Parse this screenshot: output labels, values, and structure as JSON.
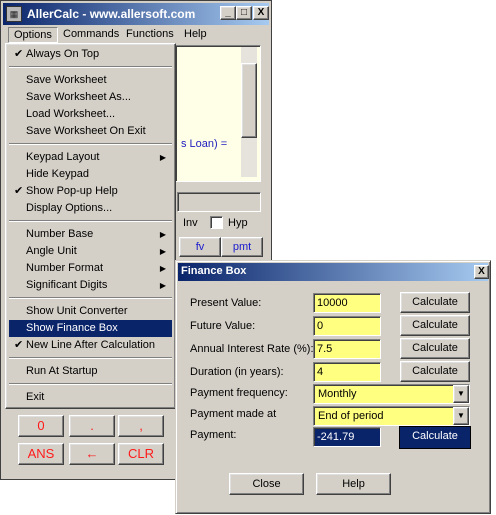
{
  "calc_window": {
    "title": "AllerCalc - www.allersoft.com",
    "app_icon": "calculator-icon",
    "minimize": "_",
    "maximize": "□",
    "close": "X",
    "menubar": [
      "Options",
      "Commands",
      "Functions",
      "Help"
    ],
    "worksheet_text": "s Loan) =",
    "inv_label": "Inv",
    "hyp_label": "Hyp",
    "fn_buttons": [
      "fv",
      "pmt"
    ],
    "keypad_row1": [
      "0",
      ".",
      ","
    ],
    "keypad_row2": [
      "ANS",
      "←",
      "CLR"
    ]
  },
  "options_menu": {
    "items": [
      {
        "label": "Always On Top",
        "checked": true
      },
      {
        "sep": true
      },
      {
        "label": "Save Worksheet"
      },
      {
        "label": "Save Worksheet As..."
      },
      {
        "label": "Load Worksheet..."
      },
      {
        "label": "Save Worksheet On Exit"
      },
      {
        "sep": true
      },
      {
        "label": "Keypad Layout",
        "submenu": true
      },
      {
        "label": "Hide Keypad"
      },
      {
        "label": "Show Pop-up Help",
        "checked": true
      },
      {
        "label": "Display Options..."
      },
      {
        "sep": true
      },
      {
        "label": "Number Base",
        "submenu": true
      },
      {
        "label": "Angle Unit",
        "submenu": true
      },
      {
        "label": "Number Format",
        "submenu": true
      },
      {
        "label": "Significant Digits",
        "submenu": true
      },
      {
        "sep": true
      },
      {
        "label": "Show Unit Converter"
      },
      {
        "label": "Show Finance Box",
        "selected": true
      },
      {
        "label": "New Line After Calculation",
        "checked": true
      },
      {
        "sep": true
      },
      {
        "label": "Run At Startup"
      },
      {
        "sep": true
      },
      {
        "label": "Exit"
      }
    ]
  },
  "finance_box": {
    "title": "Finance Box",
    "close": "X",
    "rows": [
      {
        "label": "Present Value:",
        "value": "10000",
        "button": "Calculate"
      },
      {
        "label": "Future Value:",
        "value": "0",
        "button": "Calculate"
      },
      {
        "label": "Annual Interest Rate (%):",
        "value": "7.5",
        "button": "Calculate"
      },
      {
        "label": "Duration (in years):",
        "value": "4",
        "button": "Calculate"
      }
    ],
    "payment_frequency": {
      "label": "Payment frequency:",
      "value": "Monthly"
    },
    "payment_made_at": {
      "label": "Payment made at",
      "value": "End of period"
    },
    "payment": {
      "label": "Payment:",
      "value": "-241.79",
      "button": "Calculate"
    },
    "close_button": "Close",
    "help_button": "Help"
  },
  "colors": {
    "titlebar": "#0a246a",
    "window_face": "#d4d0c8",
    "input_yellow": "#ffff80",
    "keypad_red": "#ff1a1a",
    "fn_blue": "#1a1acc"
  }
}
